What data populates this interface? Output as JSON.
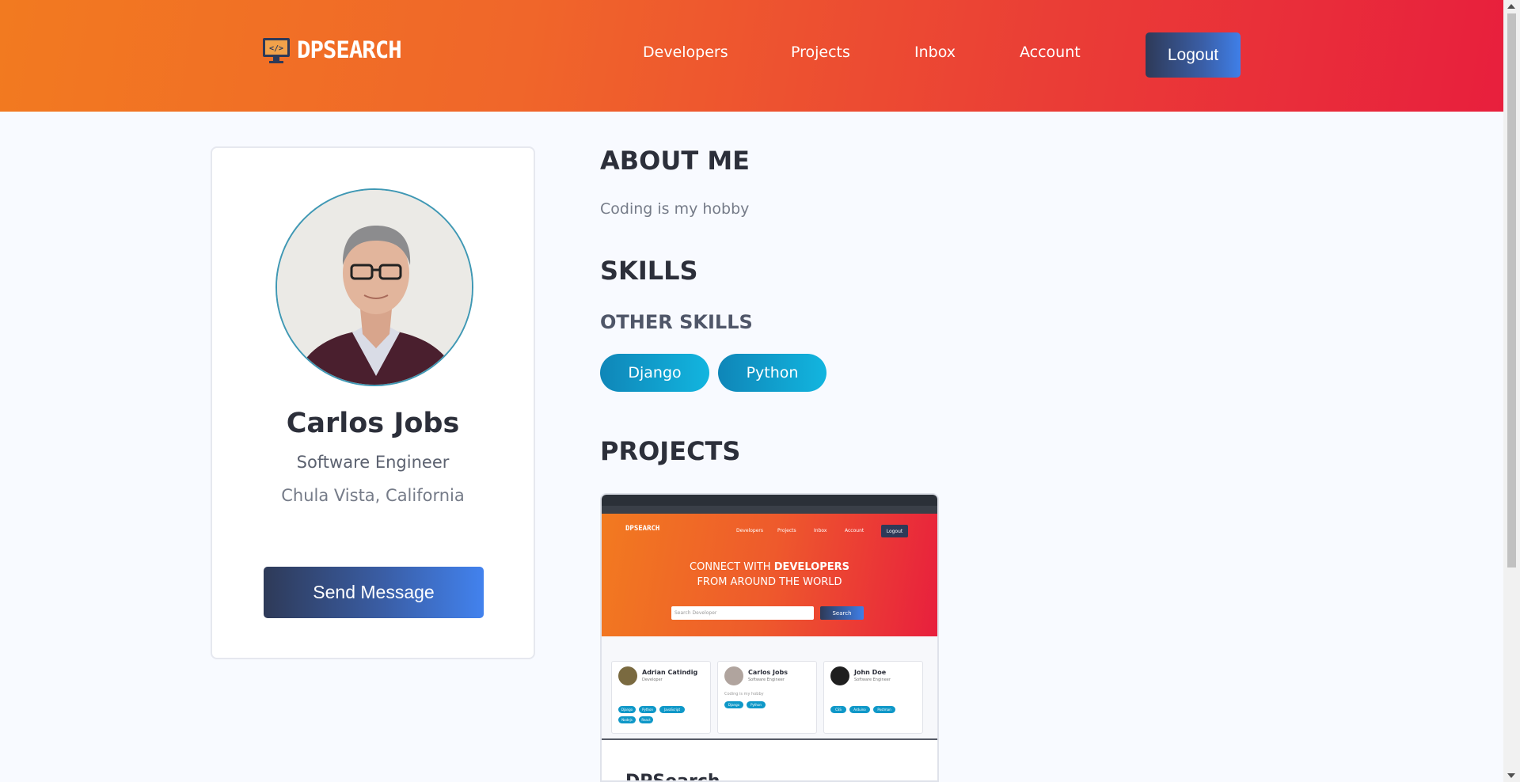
{
  "brand": {
    "name": "DPSEARCH",
    "icon": "monitor-code-icon"
  },
  "nav": {
    "items": [
      "Developers",
      "Projects",
      "Inbox",
      "Account"
    ],
    "logout_label": "Logout"
  },
  "profile": {
    "name": "Carlos Jobs",
    "title": "Software Engineer",
    "location": "Chula Vista, California",
    "send_label": "Send Message"
  },
  "about": {
    "heading": "ABOUT ME",
    "text": "Coding is my hobby"
  },
  "skills": {
    "heading": "SKILLS",
    "other_heading": "OTHER SKILLS",
    "other": [
      "Django",
      "Python"
    ]
  },
  "projects": {
    "heading": "PROJECTS",
    "preview": {
      "brand": "DPSEARCH",
      "nav": [
        "Developers",
        "Projects",
        "Inbox",
        "Account"
      ],
      "logout": "Logout",
      "headline_line1_a": "CONNECT WITH ",
      "headline_line1_b": "DEVELOPERS",
      "headline_line2": "FROM AROUND THE WORLD",
      "search_placeholder": "Search Developer",
      "search_button": "Search",
      "developers": [
        {
          "name": "Adrian Catindig",
          "role": "Developer",
          "skills": [
            "Django",
            "Python",
            "JavaScript",
            "Nodejs",
            "React"
          ]
        },
        {
          "name": "Carlos Jobs",
          "role": "Software Engineer",
          "bio": "Coding is my hobby",
          "skills": [
            "Django",
            "Python"
          ]
        },
        {
          "name": "John Doe",
          "role": "Software Engineer",
          "skills": [
            "CSS",
            "Arduino",
            "Postman"
          ]
        }
      ],
      "bottom_title": "DPSearch"
    }
  },
  "colors": {
    "header_start": "#f27a20",
    "header_end": "#e81f3d",
    "button_dark": "#2e3a58",
    "button_blue": "#4282ee",
    "chip": "#12b5df"
  }
}
